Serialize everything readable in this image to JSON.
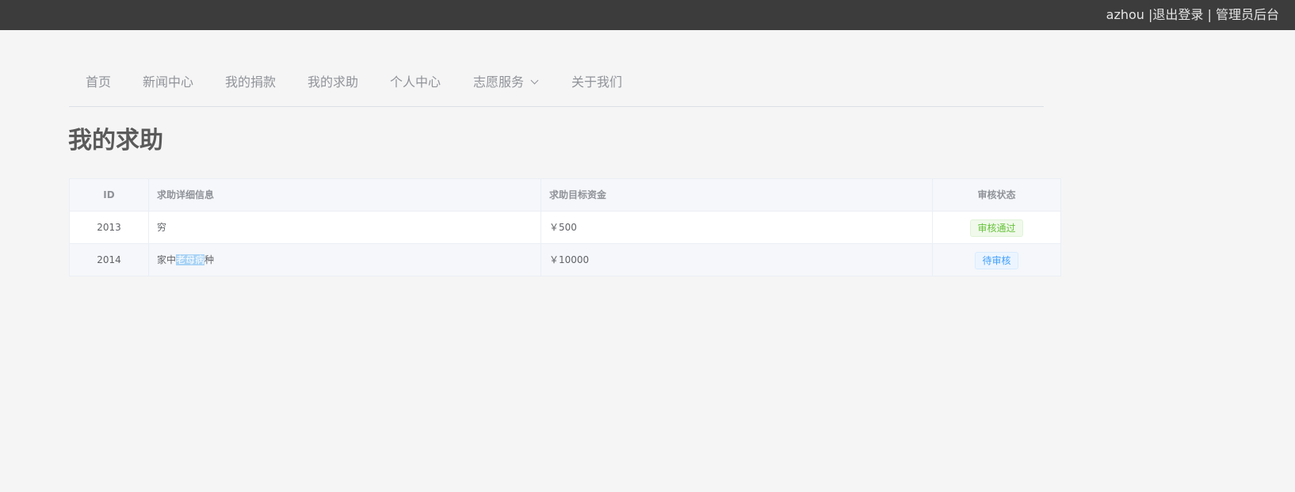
{
  "topbar": {
    "username": "azhou",
    "sep1": " |",
    "logout": "退出登录",
    "sep2": " | ",
    "admin": "管理员后台"
  },
  "nav": {
    "items": [
      {
        "label": "首页"
      },
      {
        "label": "新闻中心"
      },
      {
        "label": "我的捐款"
      },
      {
        "label": "我的求助"
      },
      {
        "label": "个人中心"
      },
      {
        "label": "志愿服务"
      },
      {
        "label": "关于我们"
      }
    ]
  },
  "page": {
    "title": "我的求助"
  },
  "table": {
    "headers": {
      "id": "ID",
      "info": "求助详细信息",
      "amount": "求助目标资金",
      "status": "审核状态"
    },
    "rows": [
      {
        "id": "2013",
        "info": "穷",
        "amount": "￥500",
        "status": "审核通过"
      },
      {
        "id": "2014",
        "info_before": "家中",
        "info_selected": "老母病",
        "info_after": "种",
        "amount": "￥10000",
        "status": "待审核"
      }
    ]
  },
  "colors": {
    "topbar_bg": "#3c3c3c",
    "page_bg": "#f5f5f5",
    "success": "#67c23a",
    "info": "#409eff"
  }
}
